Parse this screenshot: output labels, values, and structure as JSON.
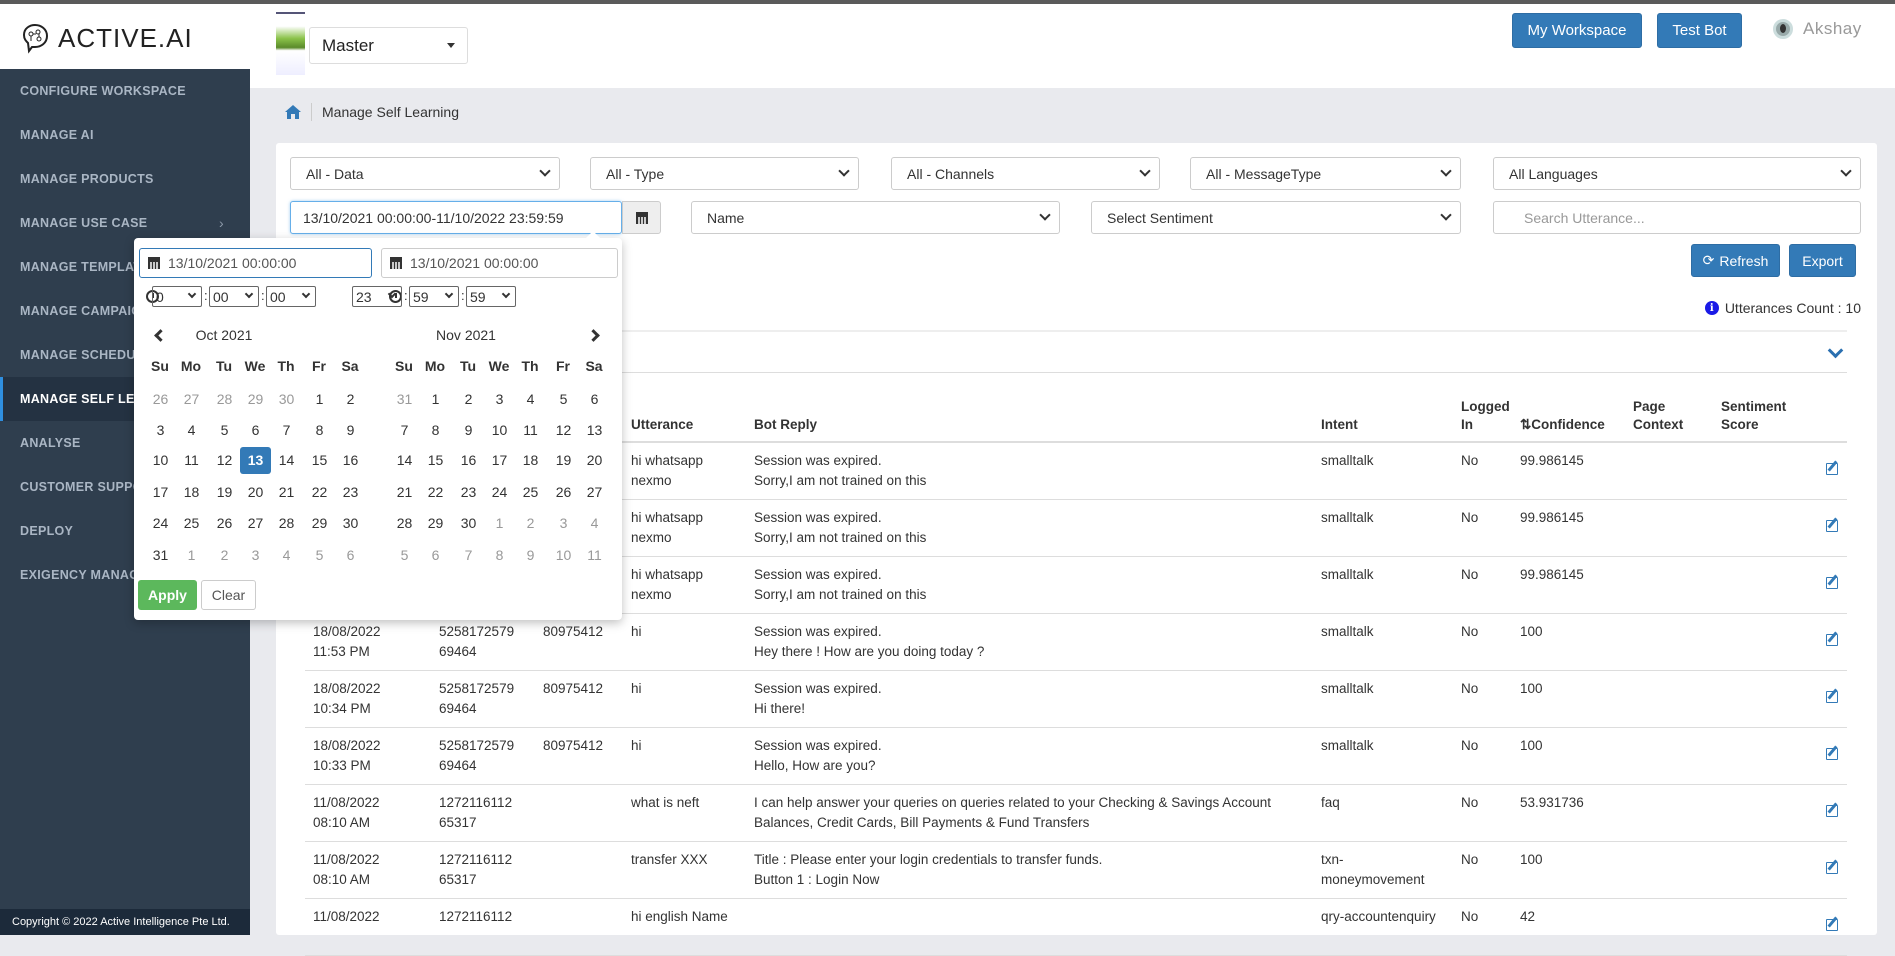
{
  "app": {
    "logo_text": "ACTIVE.AI",
    "copyright": "Copyright © 2022 Active Intelligence Pte Ltd."
  },
  "sidebar": {
    "items": [
      {
        "label": "CONFIGURE WORKSPACE"
      },
      {
        "label": "MANAGE AI"
      },
      {
        "label": "MANAGE PRODUCTS"
      },
      {
        "label": "MANAGE USE CASE",
        "chevron": true
      },
      {
        "label": "MANAGE TEMPLATES"
      },
      {
        "label": "MANAGE CAMPAIGNS"
      },
      {
        "label": "MANAGE SCHEDULES"
      },
      {
        "label": "MANAGE SELF LEARNING",
        "active": true
      },
      {
        "label": "ANALYSE"
      },
      {
        "label": "CUSTOMER SUPPORT"
      },
      {
        "label": "DEPLOY"
      },
      {
        "label": "EXIGENCY MANAGEMENT"
      }
    ]
  },
  "header": {
    "workspace_select": "Master",
    "my_workspace": "My Workspace",
    "test_bot": "Test Bot",
    "user": "Akshay"
  },
  "breadcrumb": {
    "current": "Manage Self Learning"
  },
  "filters": {
    "data": "All - Data",
    "type": "All - Type",
    "channels": "All - Channels",
    "message_type": "All - MessageType",
    "languages": "All Languages",
    "date_range": "13/10/2021 00:00:00-11/10/2022 23:59:59",
    "name": "Name",
    "sentiment": "Select Sentiment",
    "search_placeholder": "Search Utterance..."
  },
  "actions": {
    "refresh": "Refresh",
    "export": "Export"
  },
  "utterances_count": "Utterances Count : 10",
  "colors": {
    "primary": "#337ab7",
    "apply": "#5cb85c",
    "sidebar": "#2f3e4e"
  },
  "picker": {
    "start_input": "13/10/2021 00:00:00",
    "end_input": "13/10/2021 00:00:00",
    "start_time": [
      "0",
      "00",
      "00"
    ],
    "end_time": [
      "23",
      "59",
      "59"
    ],
    "days_of_week": [
      "Su",
      "Mo",
      "Tu",
      "We",
      "Th",
      "Fr",
      "Sa"
    ],
    "months": [
      {
        "title": "Oct 2021",
        "days": [
          "26",
          "27",
          "28",
          "29",
          "30",
          "1",
          "2",
          "3",
          "4",
          "5",
          "6",
          "7",
          "8",
          "9",
          "10",
          "11",
          "12",
          "13",
          "14",
          "15",
          "16",
          "17",
          "18",
          "19",
          "20",
          "21",
          "22",
          "23",
          "24",
          "25",
          "26",
          "27",
          "28",
          "29",
          "30",
          "31",
          "1",
          "2",
          "3",
          "4",
          "5",
          "6"
        ],
        "off": [
          0,
          1,
          2,
          3,
          4,
          36,
          37,
          38,
          39,
          40,
          41
        ],
        "selected": 17
      },
      {
        "title": "Nov 2021",
        "days": [
          "31",
          "1",
          "2",
          "3",
          "4",
          "5",
          "6",
          "7",
          "8",
          "9",
          "10",
          "11",
          "12",
          "13",
          "14",
          "15",
          "16",
          "17",
          "18",
          "19",
          "20",
          "21",
          "22",
          "23",
          "24",
          "25",
          "26",
          "27",
          "28",
          "29",
          "30",
          "1",
          "2",
          "3",
          "4",
          "5",
          "6",
          "7",
          "8",
          "9",
          "10",
          "11"
        ],
        "off": [
          0,
          31,
          32,
          33,
          34,
          35,
          36,
          37,
          38,
          39,
          40,
          41
        ]
      }
    ],
    "apply": "Apply",
    "clear": "Clear"
  },
  "table": {
    "columns": [
      "",
      "",
      "",
      "Utterance",
      "Bot Reply",
      "Intent",
      "Logged\nIn",
      "⇅Confidence",
      "Page\nContext",
      "Sentiment\nScore"
    ],
    "rows": [
      [
        "",
        "",
        "",
        "hi whatsapp\nnexmo",
        "Session was expired.\nSorry,I am not trained on this",
        "smalltalk",
        "No",
        "99.986145",
        "",
        ""
      ],
      [
        "",
        "",
        "",
        "hi whatsapp\nnexmo",
        "Session was expired.\nSorry,I am not trained on this",
        "smalltalk",
        "No",
        "99.986145",
        "",
        ""
      ],
      [
        "",
        "",
        "",
        "hi whatsapp\nnexmo",
        "Session was expired.\nSorry,I am not trained on this",
        "smalltalk",
        "No",
        "99.986145",
        "",
        ""
      ],
      [
        "18/08/2022\n11:53 PM",
        "5258172579\n69464",
        "80975412",
        "hi",
        "Session was expired.\nHey there ! How are you doing today ?",
        "smalltalk",
        "No",
        "100",
        "",
        ""
      ],
      [
        "18/08/2022\n10:34 PM",
        "5258172579\n69464",
        "80975412",
        "hi",
        "Session was expired.\nHi there!",
        "smalltalk",
        "No",
        "100",
        "",
        ""
      ],
      [
        "18/08/2022\n10:33 PM",
        "5258172579\n69464",
        "80975412",
        "hi",
        "Session was expired.\nHello, How are you?",
        "smalltalk",
        "No",
        "100",
        "",
        ""
      ],
      [
        "11/08/2022\n08:10 AM",
        "1272116112\n65317",
        "",
        "what is neft",
        "I can help answer your queries on queries related to your Checking & Savings Account\nBalances, Credit Cards, Bill Payments & Fund Transfers",
        "faq",
        "No",
        "53.931736",
        "",
        ""
      ],
      [
        "11/08/2022\n08:10 AM",
        "1272116112\n65317",
        "",
        "transfer XXX",
        "Title : Please enter your login credentials to transfer funds.\nButton 1 : Login Now",
        "txn-\nmoneymovement",
        "No",
        "100",
        "",
        ""
      ],
      [
        "11/08/2022",
        "1272116112",
        "",
        "hi english Name",
        "",
        "qry-accountenquiry",
        "No",
        "42",
        "",
        ""
      ]
    ]
  }
}
